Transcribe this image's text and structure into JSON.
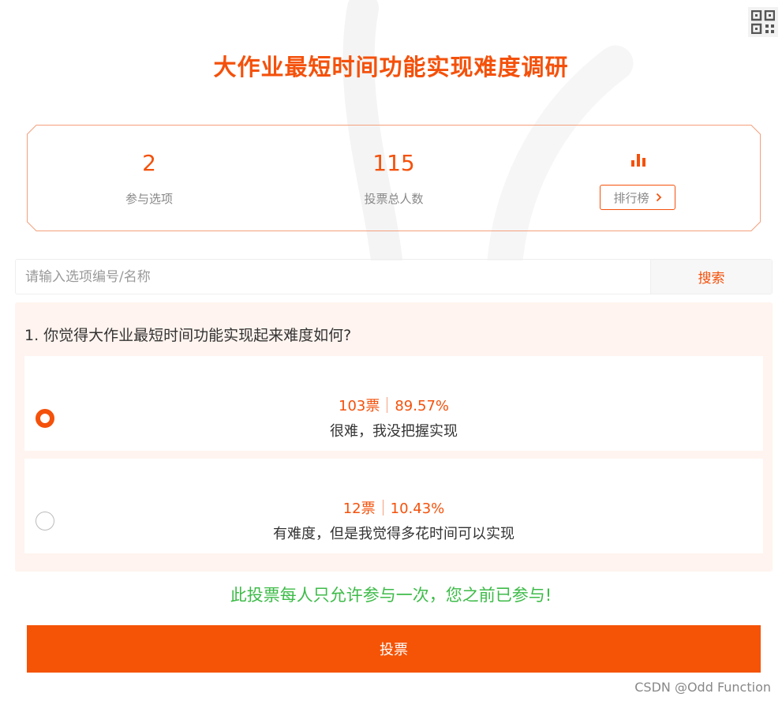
{
  "title": "大作业最短时间功能实现难度调研",
  "stats": [
    {
      "value": "2",
      "label": "参与选项"
    },
    {
      "value": "115",
      "label": "投票总人数"
    }
  ],
  "ranking": {
    "icon": "bar-chart-icon",
    "label": "排行榜"
  },
  "search": {
    "placeholder": "请输入选项编号/名称",
    "value": "",
    "button": "搜索"
  },
  "question": {
    "text": "1. 你觉得大作业最短时间功能实现起来难度如何?",
    "options": [
      {
        "votes": "103票",
        "percent": "89.57%",
        "label": "很难，我没把握实现",
        "selected": true
      },
      {
        "votes": "12票",
        "percent": "10.43%",
        "label": "有难度，但是我觉得多花时间可以实现",
        "selected": false
      }
    ]
  },
  "notice": "此投票每人只允许参与一次，您之前已参与!",
  "vote_button": "投票",
  "watermark": "CSDN @Odd Function",
  "colors": {
    "accent": "#f4510b",
    "button": "#f55305",
    "notice": "#3dbb48",
    "question_bg": "#fff4ef"
  }
}
